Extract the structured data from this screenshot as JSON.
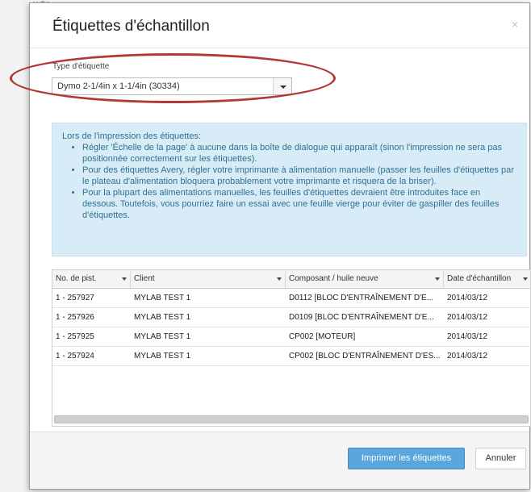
{
  "backdrop": {
    "text": "cedbn"
  },
  "dialog": {
    "title": "Étiquettes d'échantillon",
    "close_label": "×"
  },
  "label_type": {
    "label": "Type d'étiquette",
    "selected": "Dymo 2-1/4in x 1-1/4in (30334)"
  },
  "info": {
    "intro": "Lors de l'impression des étiquettes:",
    "items": [
      "Régler 'Échelle de la page' à aucune dans la boîte de dialogue qui apparaît (sinon l'impression ne sera pas positionnée correctement sur les étiquettes).",
      "Pour des étiquettes Avery, régler votre imprimante à alimentation manuelle (passer les feuilles d'étiquettes par le plateau d'alimentation bloquera probablement votre imprimante et risquera de la briser).",
      "Pour la plupart des alimentations manuelles, les feuilles d'étiquettes devraient être introduites face en dessous. Toutefois, vous pourriez faire un essai avec une feuille vierge pour éviter de gaspiller des feuilles d'étiquettes."
    ]
  },
  "grid": {
    "columns": [
      "No. de pist.",
      "Client",
      "Composant / huile neuve",
      "Date d'échantillon"
    ],
    "rows": [
      [
        "1 - 257927",
        "MYLAB TEST 1",
        "D0112 [BLOC D'ENTRAÎNEMENT D'E...",
        "2014/03/12"
      ],
      [
        "1 - 257926",
        "MYLAB TEST 1",
        "D0109 [BLOC D'ENTRAÎNEMENT D'E...",
        "2014/03/12"
      ],
      [
        "1 - 257925",
        "MYLAB TEST 1",
        "CP002 [MOTEUR]",
        "2014/03/12"
      ],
      [
        "1 - 257924",
        "MYLAB TEST 1",
        "CP002 [BLOC D'ENTRAÎNEMENT D'ES...",
        "2014/03/12"
      ]
    ]
  },
  "footer": {
    "print_label": "Imprimer les étiquettes",
    "cancel_label": "Annuler"
  },
  "colors": {
    "annotation": "#b23a36",
    "primary_button": "#5aa7de",
    "info_background": "#d8ecf8",
    "info_text": "#31708f"
  }
}
